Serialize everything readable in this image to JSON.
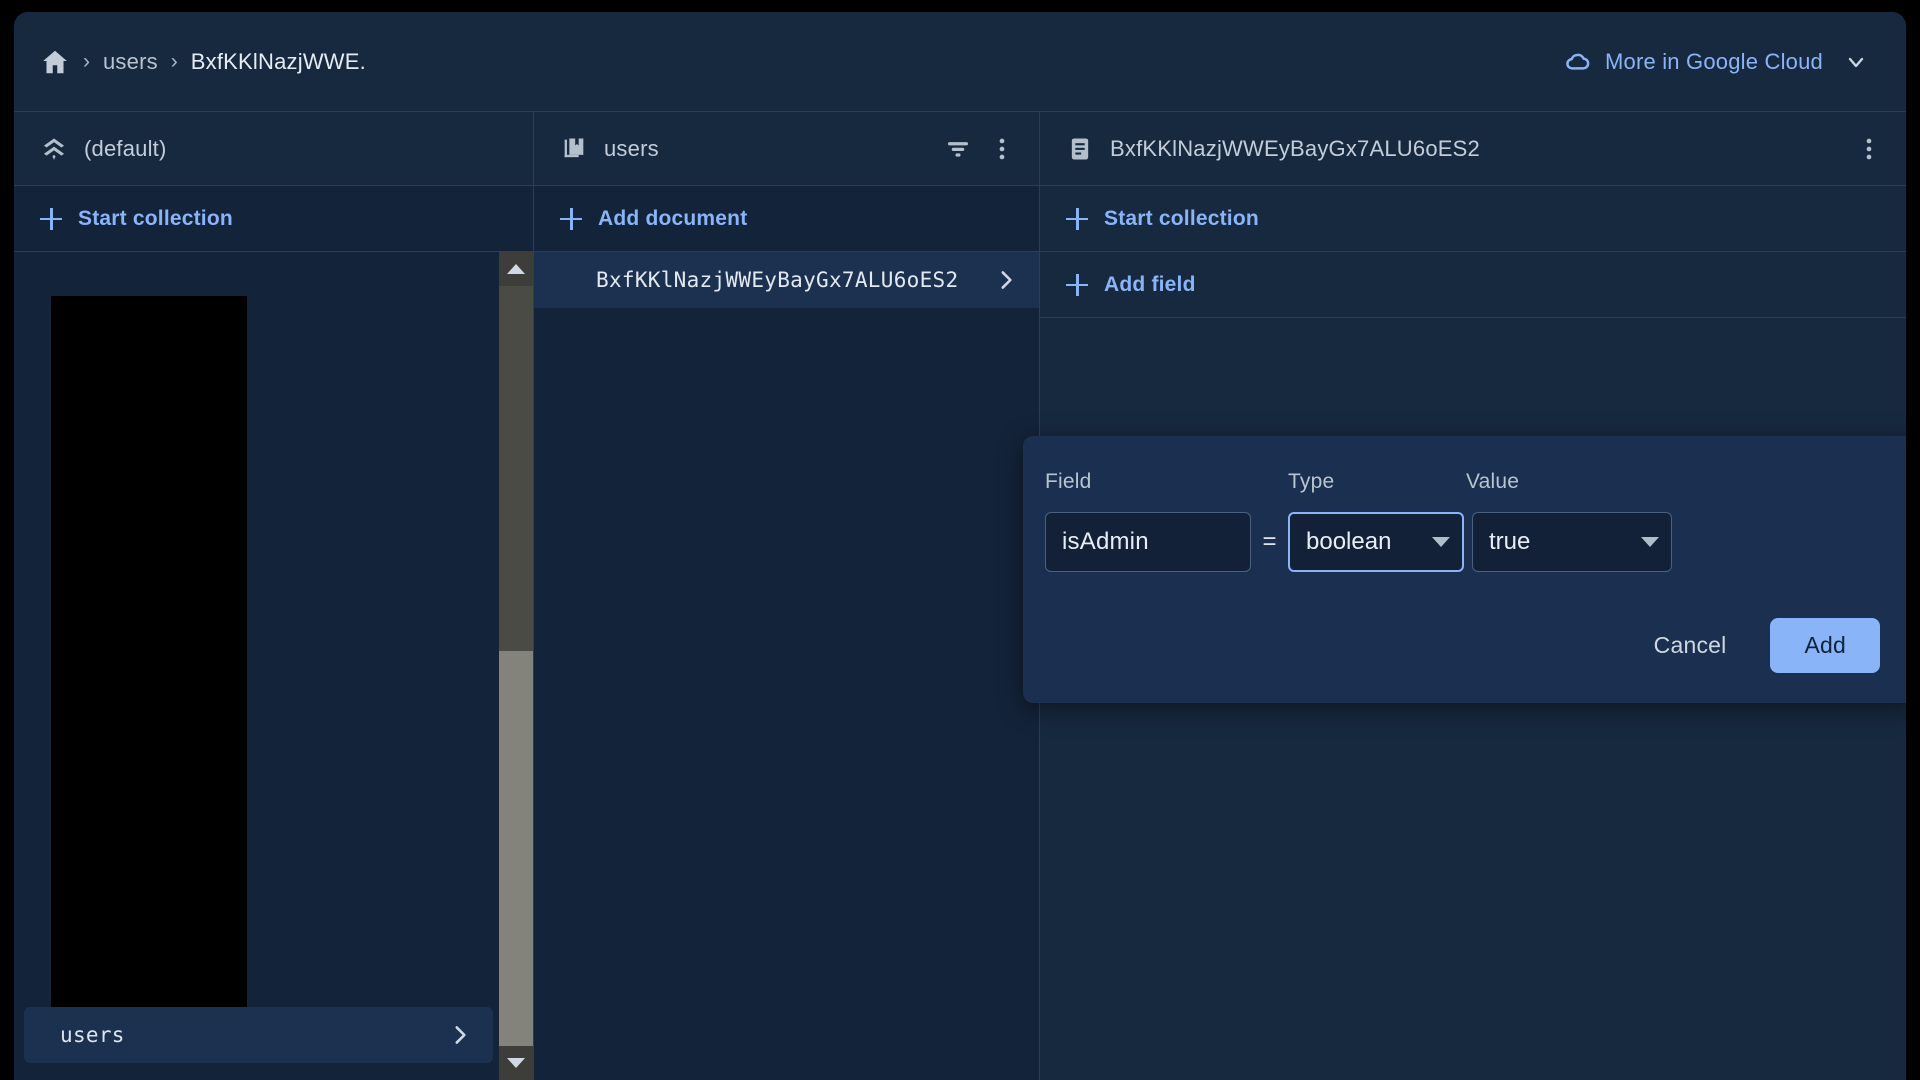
{
  "topbar": {
    "home_icon": "home-icon",
    "separator": "›",
    "crumbs": [
      {
        "label": "users"
      },
      {
        "label": "BxfKKlNazjWWE."
      }
    ],
    "cloud_button": {
      "label": "More in Google Cloud",
      "icon": "google-cloud-icon",
      "chevron": "chevron-down-icon"
    },
    "accent_blue": "#8ab4f8"
  },
  "panels": {
    "database": {
      "title": "(default)",
      "icon": "database-chevrons-icon",
      "start_collection_label": "Start collection",
      "collections": [
        {
          "name": "users",
          "selected": true
        }
      ],
      "scrollbar": {
        "up_arrow": "scroll-up-arrow-icon",
        "down_arrow": "scroll-down-arrow-icon"
      }
    },
    "collection": {
      "title": "users",
      "icon": "collection-book-icon",
      "filter_icon": "filter-icon",
      "menu_icon": "more-vert-icon",
      "add_document_label": "Add document",
      "documents": [
        {
          "id": "BxfKKlNazjWWEyBayGx7ALU6oES2",
          "selected": true
        }
      ]
    },
    "document": {
      "title": "BxfKKlNazjWWEyBayGx7ALU6oES2",
      "icon": "document-icon",
      "menu_icon": "more-vert-icon",
      "start_collection_label": "Start collection",
      "add_field_label": "Add field"
    }
  },
  "add_field_dialog": {
    "labels": {
      "field": "Field",
      "type": "Type",
      "value": "Value"
    },
    "equals_sign": "=",
    "field_value": "isAdmin",
    "type_value": "boolean",
    "value_value": "true",
    "type_focused": true,
    "cancel_label": "Cancel",
    "add_label": "Add",
    "add_button_color": "#8ab4f8"
  }
}
